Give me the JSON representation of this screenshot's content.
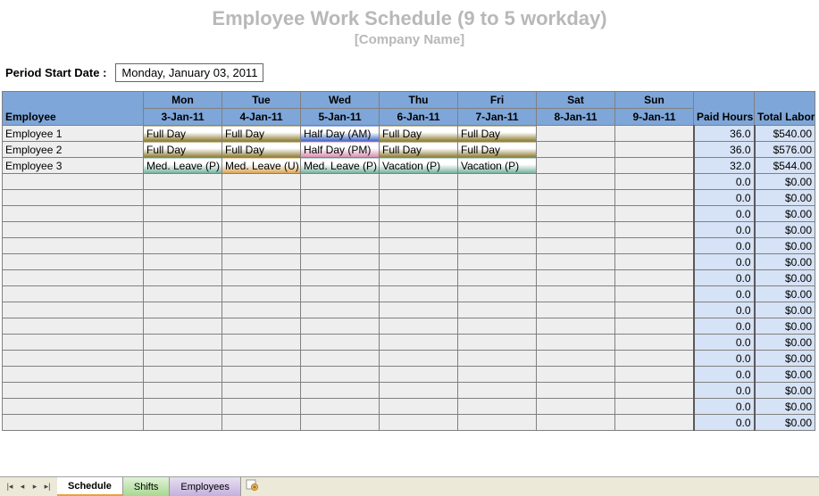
{
  "title": "Employee Work Schedule (9 to 5  workday)",
  "subtitle": "[Company Name]",
  "period_label": "Period Start Date :",
  "period_value": "Monday, January 03, 2011",
  "headers": {
    "employee": "Employee",
    "paid_hours": "Paid Hours",
    "total_cost": "Total Labor Cost"
  },
  "days": [
    {
      "dow": "Mon",
      "date": "3-Jan-11"
    },
    {
      "dow": "Tue",
      "date": "4-Jan-11"
    },
    {
      "dow": "Wed",
      "date": "5-Jan-11"
    },
    {
      "dow": "Thu",
      "date": "6-Jan-11"
    },
    {
      "dow": "Fri",
      "date": "7-Jan-11"
    },
    {
      "dow": "Sat",
      "date": "8-Jan-11"
    },
    {
      "dow": "Sun",
      "date": "9-Jan-11"
    }
  ],
  "rows": [
    {
      "name": "Employee 1",
      "slots": [
        {
          "label": "Full Day",
          "grad": "olive"
        },
        {
          "label": "Full Day",
          "grad": "olive"
        },
        {
          "label": "Half Day (AM)",
          "grad": "blue"
        },
        {
          "label": "Full Day",
          "grad": "olive"
        },
        {
          "label": "Full Day",
          "grad": "olive"
        },
        null,
        null
      ],
      "hours": "36.0",
      "cost": "$540.00"
    },
    {
      "name": "Employee 2",
      "slots": [
        {
          "label": "Full Day",
          "grad": "olive"
        },
        {
          "label": "Full Day",
          "grad": "olive"
        },
        {
          "label": "Half Day (PM)",
          "grad": "pink"
        },
        {
          "label": "Full Day",
          "grad": "olive"
        },
        {
          "label": "Full Day",
          "grad": "olive"
        },
        null,
        null
      ],
      "hours": "36.0",
      "cost": "$576.00"
    },
    {
      "name": "Employee 3",
      "slots": [
        {
          "label": "Med. Leave (P)",
          "grad": "teal"
        },
        {
          "label": "Med. Leave (U)",
          "grad": "orange"
        },
        {
          "label": "Med. Leave (P)",
          "grad": "teal"
        },
        {
          "label": "Vacation (P)",
          "grad": "teal"
        },
        {
          "label": "Vacation (P)",
          "grad": "teal"
        },
        null,
        null
      ],
      "hours": "32.0",
      "cost": "$544.00"
    }
  ],
  "empty_row_count": 16,
  "empty_hours": "0.0",
  "empty_cost": "$0.00",
  "tabs": [
    {
      "label": "Schedule",
      "style": "active"
    },
    {
      "label": "Shifts",
      "style": "green"
    },
    {
      "label": "Employees",
      "style": "purple"
    }
  ]
}
